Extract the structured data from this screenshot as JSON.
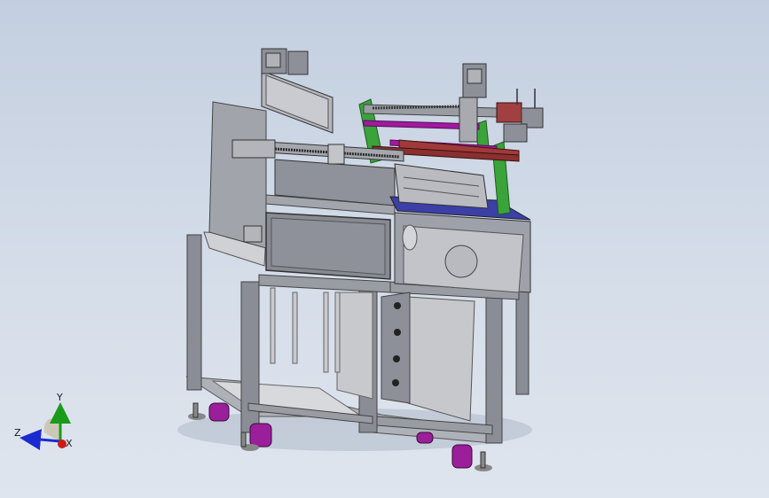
{
  "viewport": {
    "background_top": "#c3cfe0",
    "background_bottom": "#dfe5ee"
  },
  "model": {
    "frame_color": "#7d8088",
    "panel_color": "#8c8f99",
    "accent_green": "#3aa33a",
    "accent_purple": "#a01b9f",
    "accent_red": "#a03a3a",
    "table_top_color": "#3b3fa6",
    "caster_color": "#9b1f9b"
  },
  "triad": {
    "x_label": "X",
    "y_label": "Y",
    "z_label": "Z",
    "x_color": "#d01818",
    "y_color": "#1a9b1a",
    "z_color": "#1a2bd0"
  }
}
